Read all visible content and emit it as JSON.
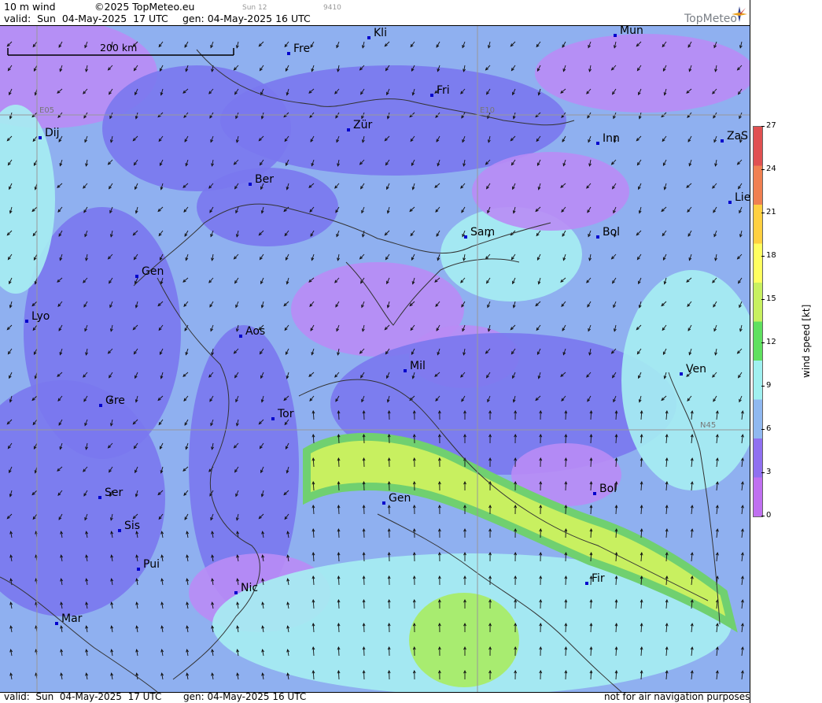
{
  "header": {
    "product": "10 m wind",
    "copyright": "©2025 TopMeteo.eu",
    "valid": "valid:  Sun  04-May-2025  17 UTC",
    "generated": "gen: 04-May-2025 16 UTC",
    "small_a": "Sun 12",
    "small_b": "9410",
    "brand": "TopMeteo"
  },
  "scale_bar": "200 km",
  "grid_labels": [
    "E05",
    "E10",
    "N45"
  ],
  "cities": [
    {
      "name": "Kli"
    },
    {
      "name": "Mun"
    },
    {
      "name": "Fre"
    },
    {
      "name": "Fri"
    },
    {
      "name": "Zür"
    },
    {
      "name": "Dij"
    },
    {
      "name": "Inn"
    },
    {
      "name": "ZaS"
    },
    {
      "name": "Ber"
    },
    {
      "name": "Lie"
    },
    {
      "name": "Sam"
    },
    {
      "name": "Bol"
    },
    {
      "name": "Gen"
    },
    {
      "name": "Lyo"
    },
    {
      "name": "Aos"
    },
    {
      "name": "Mil"
    },
    {
      "name": "Ven"
    },
    {
      "name": "Gre"
    },
    {
      "name": "Tor"
    },
    {
      "name": "Ser"
    },
    {
      "name": "Gen"
    },
    {
      "name": "Bol"
    },
    {
      "name": "Sis"
    },
    {
      "name": "Pui"
    },
    {
      "name": "Fir"
    },
    {
      "name": "Nic"
    },
    {
      "name": "Mar"
    }
  ],
  "legend": {
    "title": "wind speed [kt]",
    "ticks": [
      "27",
      "24",
      "21",
      "18",
      "15",
      "12",
      "9",
      "6",
      "3",
      "0"
    ],
    "colors": [
      "#e05050",
      "#f08050",
      "#ffd040",
      "#ffff60",
      "#c8f060",
      "#60e060",
      "#a0f0f0",
      "#90b8f0",
      "#9070f0",
      "#c070f0"
    ]
  },
  "footer": {
    "valid": "valid:  Sun  04-May-2025  17 UTC",
    "generated": "gen: 04-May-2025 16 UTC",
    "disclaimer": "not for air navigation purposes"
  }
}
